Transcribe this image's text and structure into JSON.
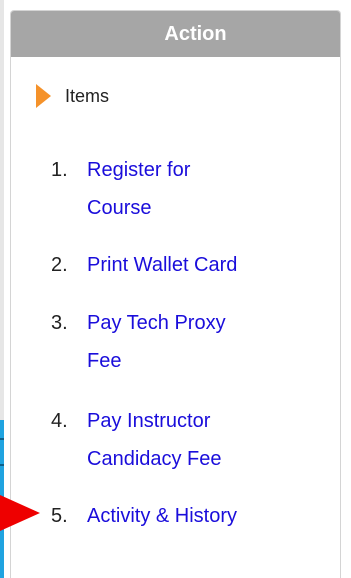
{
  "panel": {
    "title": "Action",
    "section": {
      "label": "Items",
      "icon": "triangle-right-icon",
      "icon_color": "#f5922a"
    },
    "items": [
      {
        "number": "1.",
        "label": "Register for Course"
      },
      {
        "number": "2.",
        "label": "Print Wallet Card"
      },
      {
        "number": "3.",
        "label": "Pay Tech Proxy Fee"
      },
      {
        "number": "4.",
        "label": "Pay Instructor Candidacy Fee"
      },
      {
        "number": "5.",
        "label": "Activity & History"
      }
    ]
  },
  "colors": {
    "header_bg": "#a6a6a6",
    "link": "#1a0ddb",
    "pointer": "#ee0000",
    "left_strip": "#1fa3e0"
  }
}
